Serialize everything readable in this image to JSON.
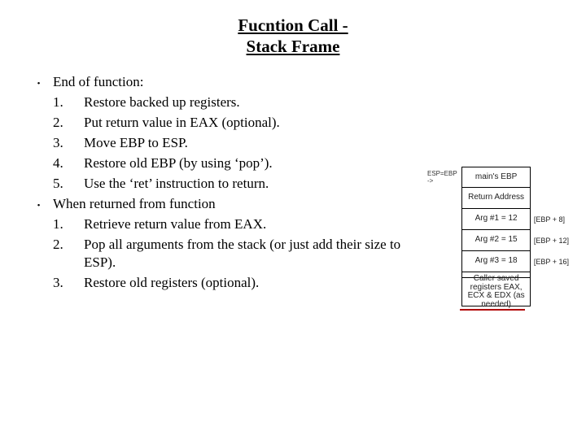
{
  "title_line1": "Fucntion Call -",
  "title_line2": "Stack Frame",
  "section1": {
    "heading": "End of function:",
    "items": [
      "Restore backed up registers.",
      "Put return value in EAX (optional).",
      "Move EBP to ESP.",
      "Restore old EBP (by using ‘pop’).",
      "Use the ‘ret’ instruction to return."
    ]
  },
  "section2": {
    "heading": "When returned from function",
    "items": [
      "Retrieve return value from EAX.",
      "Pop all arguments from the stack (or just add their size to ESP).",
      "Restore old registers (optional)."
    ]
  },
  "numerals": [
    "1.",
    "2.",
    "3.",
    "4.",
    "5."
  ],
  "bullet_glyph": "•",
  "stack": {
    "pointer_label": "ESP=EBP ->",
    "rows": [
      {
        "cell": "main's EBP",
        "right": ""
      },
      {
        "cell": "Return Address",
        "right": ""
      },
      {
        "cell": "Arg #1 = 12",
        "right": "[EBP + 8]"
      },
      {
        "cell": "Arg #2 = 15",
        "right": "[EBP + 12]"
      },
      {
        "cell": "Arg #3 = 18",
        "right": "[EBP + 16]"
      }
    ],
    "caller_saved": "Caller saved registers EAX, ECX & EDX (as needed)"
  }
}
